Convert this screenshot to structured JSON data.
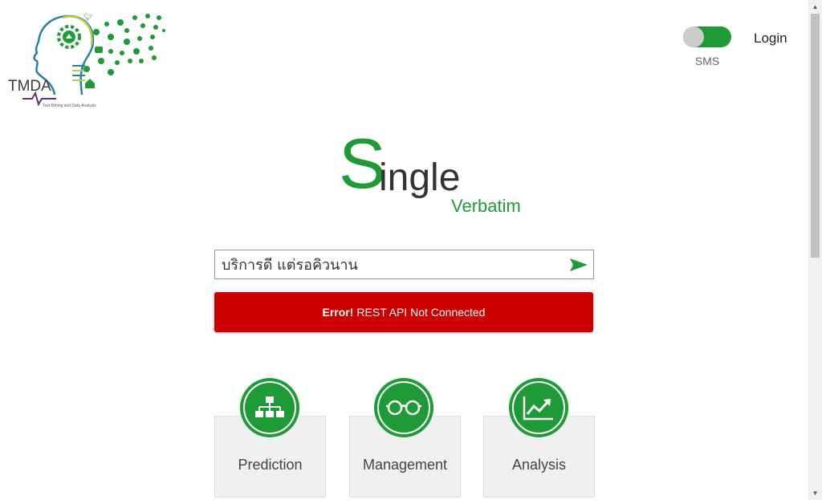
{
  "logo": {
    "text": "TMDA",
    "tagline": "Text Mining and Data Analysis"
  },
  "header": {
    "sms_toggle_label": "SMS",
    "login_label": "Login"
  },
  "brand": {
    "first_letter": "S",
    "rest": "ingle",
    "subtitle": "Verbatim"
  },
  "search": {
    "value": "บริการดี แต่รอคิวนาน"
  },
  "error": {
    "prefix": "Error!",
    "message": "REST API Not Connected"
  },
  "cards": [
    {
      "label": "Prediction",
      "icon": "sitemap-icon"
    },
    {
      "label": "Management",
      "icon": "glasses-icon"
    },
    {
      "label": "Analysis",
      "icon": "chart-line-icon"
    }
  ],
  "colors": {
    "accent": "#1e9a37",
    "error": "#cc0000"
  }
}
